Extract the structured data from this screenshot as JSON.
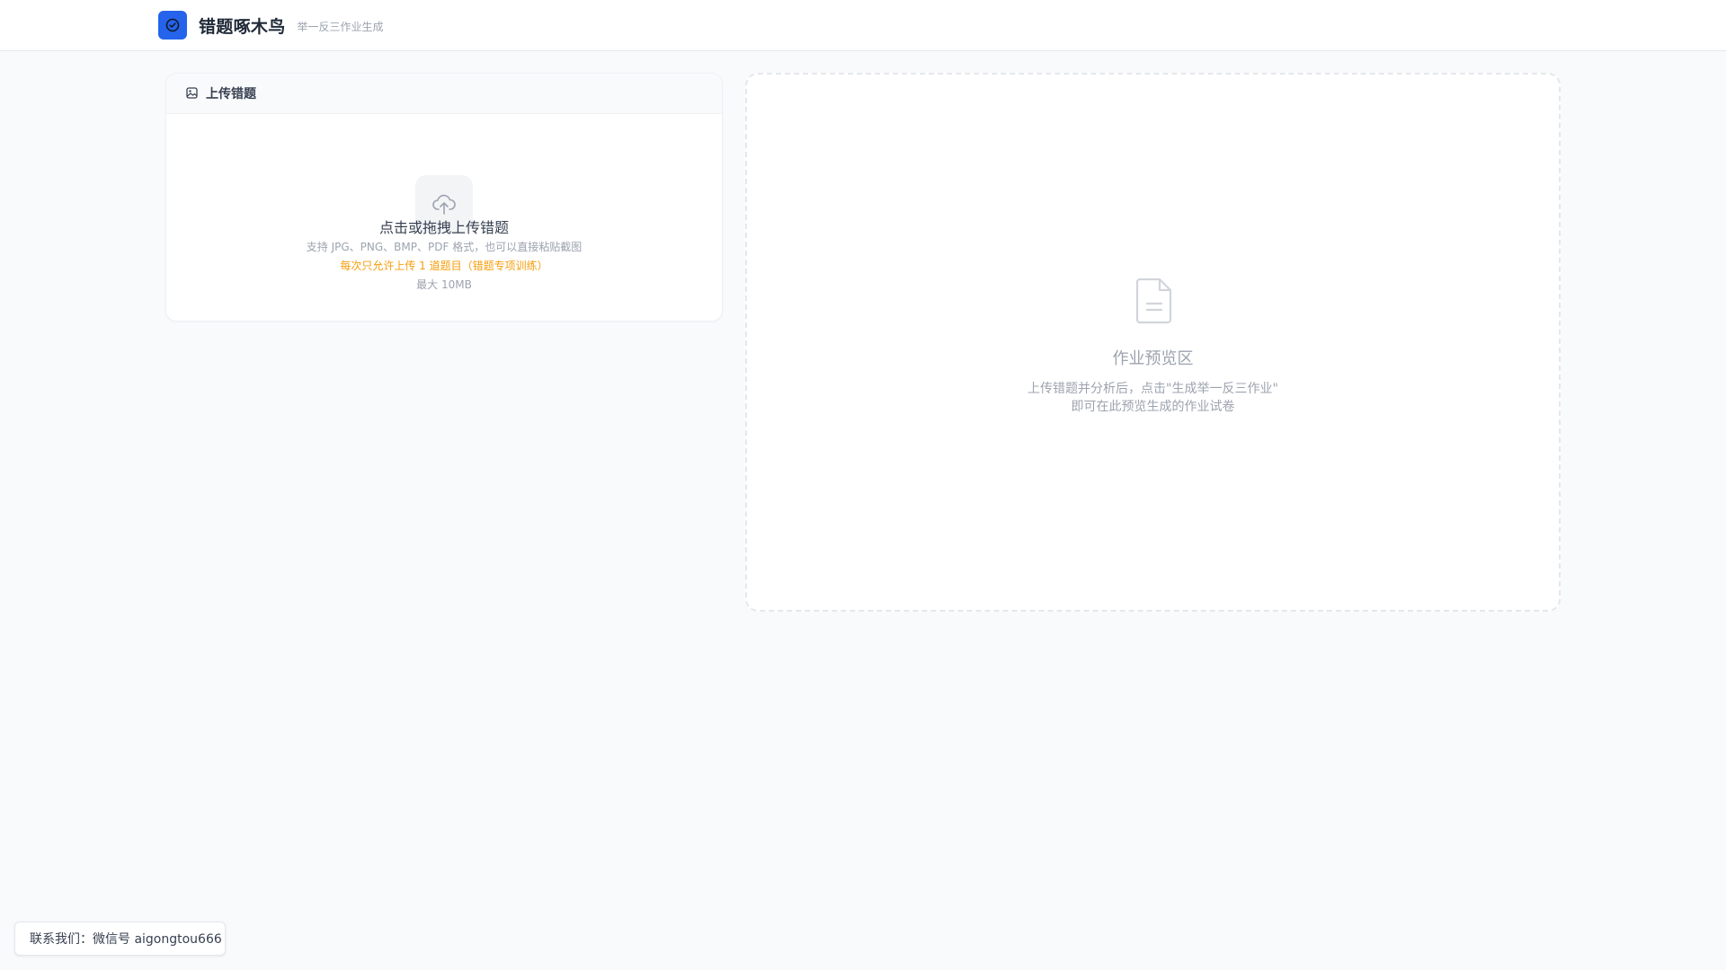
{
  "header": {
    "title": "错题啄木鸟",
    "subtitle": "举一反三作业生成",
    "logo_icon": "check-circle-icon",
    "accent_color": "#2563eb"
  },
  "upload_card": {
    "title": "上传错题",
    "title_icon": "image-icon",
    "drop_icon": "cloud-upload-icon",
    "main_text": "点击或拖拽上传错题",
    "formats_text": "支持 JPG、PNG、BMP、PDF 格式，也可以直接粘贴截图",
    "limit_text": "每次只允许上传 1 道题目（错题专项训练）",
    "size_text": "最大 10MB",
    "limit_color": "#f59e0b"
  },
  "preview": {
    "icon": "document-icon",
    "title": "作业预览区",
    "desc_line1": "上传错题并分析后，点击\"生成举一反三作业\"",
    "desc_line2": "即可在此预览生成的作业试卷"
  },
  "contact": {
    "text": "联系我们：微信号 aigongtou666"
  }
}
